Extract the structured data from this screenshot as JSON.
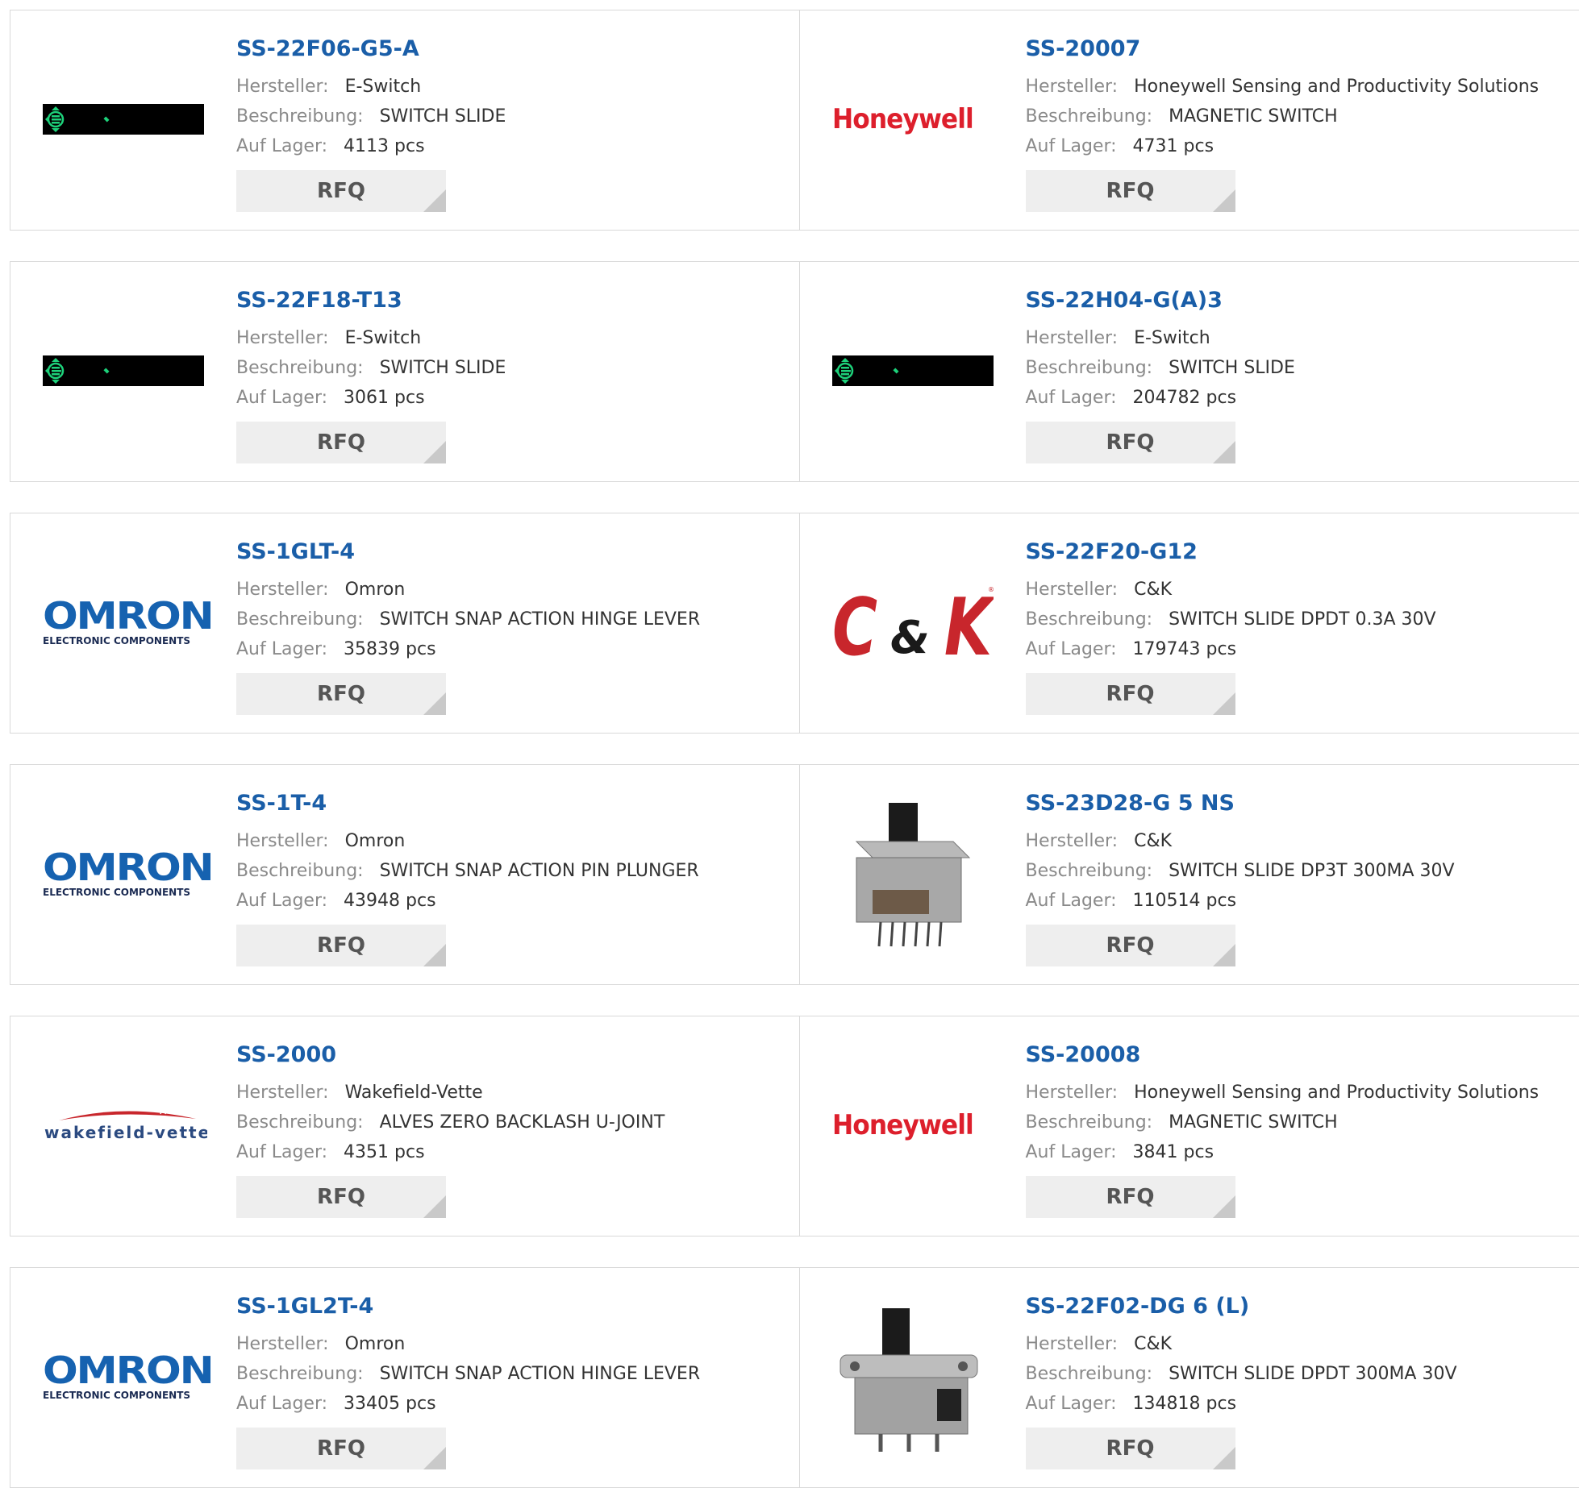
{
  "labels": {
    "manufacturer": "Hersteller:",
    "description": "Beschreibung:",
    "stock": "Auf Lager:",
    "rfq": "RFQ"
  },
  "products": [
    {
      "part": "SS-22F06-G5-A",
      "manufacturer": "E-Switch",
      "description": "SWITCH SLIDE",
      "stock": "4113 pcs",
      "logo": "eswitch-logo"
    },
    {
      "part": "SS-20007",
      "manufacturer": "Honeywell Sensing and Productivity Solutions",
      "description": "MAGNETIC SWITCH",
      "stock": "4731 pcs",
      "logo": "honeywell-logo",
      "logo_text": "Honeywell"
    },
    {
      "part": "SS-22F18-T13",
      "manufacturer": "E-Switch",
      "description": "SWITCH SLIDE",
      "stock": "3061 pcs",
      "logo": "eswitch-logo"
    },
    {
      "part": "SS-22H04-G(A)3",
      "manufacturer": "E-Switch",
      "description": "SWITCH SLIDE",
      "stock": "204782 pcs",
      "logo": "eswitch-logo"
    },
    {
      "part": "SS-1GLT-4",
      "manufacturer": "Omron",
      "description": "SWITCH SNAP ACTION HINGE LEVER",
      "stock": "35839 pcs",
      "logo": "omron-logo",
      "logo_text": "OMRON",
      "logo_subtext": "ELECTRONIC COMPONENTS"
    },
    {
      "part": "SS-22F20-G12",
      "manufacturer": "C&K",
      "description": "SWITCH SLIDE DPDT 0.3A 30V",
      "stock": "179743 pcs",
      "logo": "ck-logo",
      "logo_text": "C&K"
    },
    {
      "part": "SS-1T-4",
      "manufacturer": "Omron",
      "description": "SWITCH SNAP ACTION PIN PLUNGER",
      "stock": "43948 pcs",
      "logo": "omron-logo",
      "logo_text": "OMRON",
      "logo_subtext": "ELECTRONIC COMPONENTS"
    },
    {
      "part": "SS-23D28-G 5 NS",
      "manufacturer": "C&K",
      "description": "SWITCH SLIDE DP3T 300MA 30V",
      "stock": "110514 pcs",
      "logo": "slide-switch-photo-a"
    },
    {
      "part": "SS-2000",
      "manufacturer": "Wakefield-Vette",
      "description": "ALVES ZERO BACKLASH U-JOINT",
      "stock": "4351 pcs",
      "logo": "wakefield-logo",
      "logo_text": "wakefield-vette"
    },
    {
      "part": "SS-20008",
      "manufacturer": "Honeywell Sensing and Productivity Solutions",
      "description": "MAGNETIC SWITCH",
      "stock": "3841 pcs",
      "logo": "honeywell-logo",
      "logo_text": "Honeywell"
    },
    {
      "part": "SS-1GL2T-4",
      "manufacturer": "Omron",
      "description": "SWITCH SNAP ACTION HINGE LEVER",
      "stock": "33405 pcs",
      "logo": "omron-logo",
      "logo_text": "OMRON",
      "logo_subtext": "ELECTRONIC COMPONENTS"
    },
    {
      "part": "SS-22F02-DG 6 (L)",
      "manufacturer": "C&K",
      "description": "SWITCH SLIDE DPDT 300MA 30V",
      "stock": "134818 pcs",
      "logo": "slide-switch-photo-b"
    }
  ],
  "colors": {
    "link": "#1a5ea8",
    "label": "#8a8a8a",
    "value": "#333333",
    "button_bg": "#eeeeee",
    "honeywell_red": "#dd1f2c",
    "omron_blue": "#1662b0",
    "ck_red": "#c8262c",
    "eswitch_green": "#1dd17a"
  }
}
